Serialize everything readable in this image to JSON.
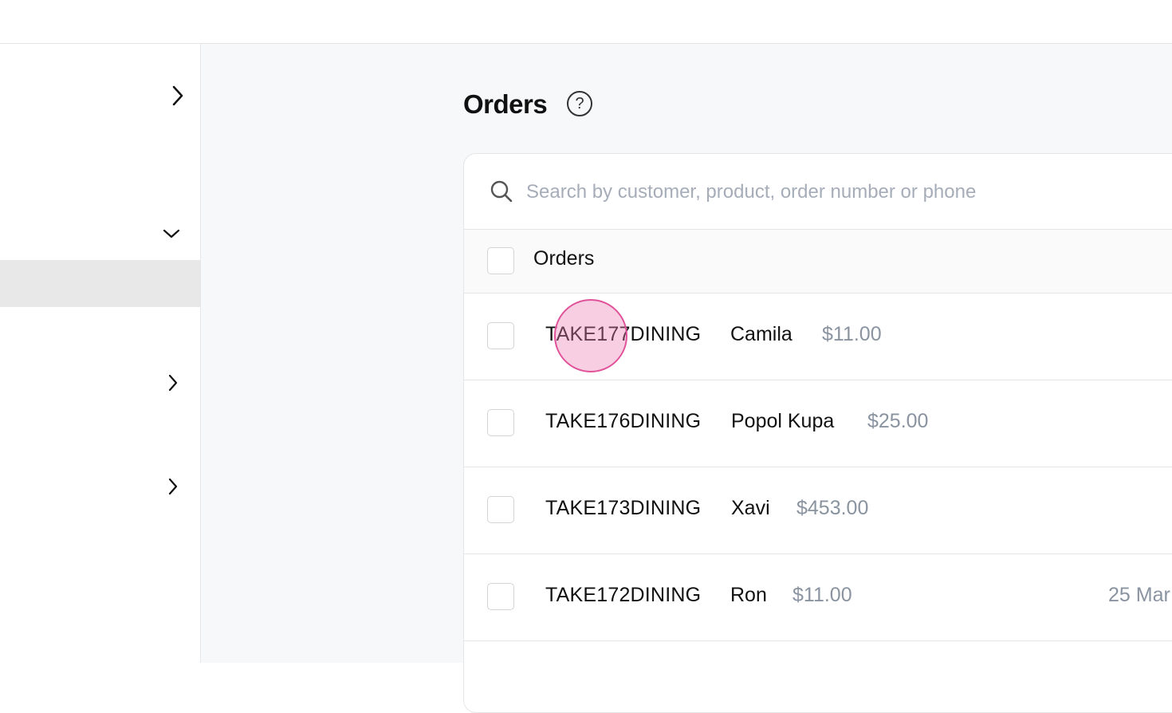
{
  "page": {
    "title": "Orders"
  },
  "search": {
    "placeholder": "Search by customer, product, order number or phone"
  },
  "table": {
    "header_label": "Orders",
    "rows": [
      {
        "order_id": "TAKE177DINING",
        "customer": "Camila",
        "amount": "$11.00",
        "date": ""
      },
      {
        "order_id": "TAKE176DINING",
        "customer": "Popol Kupa",
        "amount": "$25.00",
        "date": ""
      },
      {
        "order_id": "TAKE173DINING",
        "customer": "Xavi",
        "amount": "$453.00",
        "date": ""
      },
      {
        "order_id": "TAKE172DINING",
        "customer": "Ron",
        "amount": "$11.00",
        "date": "25 Mar"
      }
    ]
  },
  "icons": {
    "help": "question-circle-icon",
    "search": "search-icon",
    "sidebar_expand": "chevron-right-icon",
    "sidebar_collapse": "chevron-down-icon"
  },
  "colors": {
    "accent_marker": "#e0529a",
    "muted_text": "#8a93a0",
    "placeholder_text": "#a6adb8"
  }
}
